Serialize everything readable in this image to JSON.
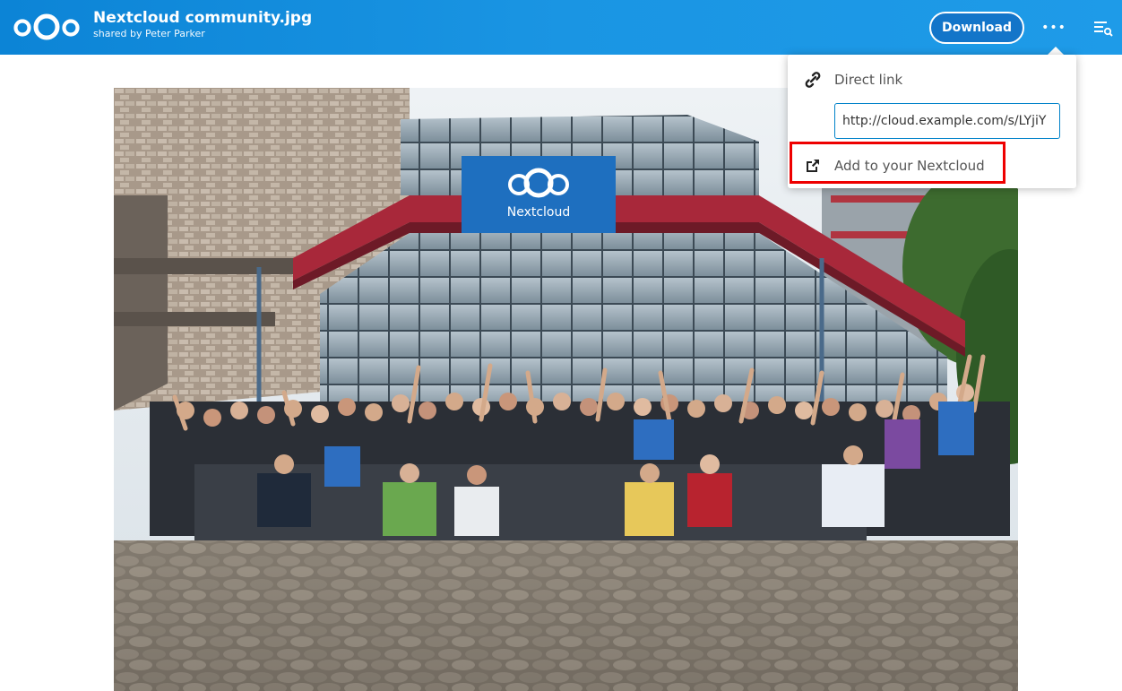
{
  "header": {
    "file_title": "Nextcloud community.jpg",
    "shared_by": "shared by Peter Parker",
    "download_label": "Download",
    "more_label": "•••",
    "logo_icon": "nextcloud-logo-icon",
    "details_icon": "details-list-icon"
  },
  "menu": {
    "direct_link_label": "Direct link",
    "direct_link_icon": "link-icon",
    "link_value": "http://cloud.example.com/s/LYjiY",
    "add_label": "Add to your Nextcloud",
    "add_icon": "external-link-icon"
  },
  "photo": {
    "banner_text": "Nextcloud",
    "description": ""
  },
  "colors": {
    "header_bg": "#1a95e3",
    "accent": "#0082c9",
    "highlight": "#ee0000"
  }
}
